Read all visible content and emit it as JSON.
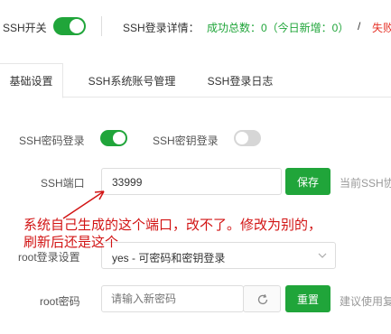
{
  "header": {
    "ssh_switch_label": "SSH开关",
    "detail_label": "SSH登录详情：",
    "success_text": "成功总数：0（今日新增：0）",
    "separator": "/",
    "fail_text": "失败"
  },
  "tabs": [
    {
      "label": "基础设置"
    },
    {
      "label": "SSH系统账号管理"
    },
    {
      "label": "SSH登录日志"
    }
  ],
  "settings": {
    "pwd_login_label": "SSH密码登录",
    "key_login_label": "SSH密钥登录",
    "port_label": "SSH端口",
    "port_value": "33999",
    "save_button": "保存",
    "current_ssh_hint": "当前SSH协",
    "root_login_label": "root登录设置",
    "root_login_value": "yes - 可密码和密钥登录",
    "root_pwd_label": "root密码",
    "root_pwd_placeholder": "请输入新密码",
    "reset_button": "重置",
    "suggest_hint": "建议使用复"
  },
  "annotation": {
    "line1": "系统自己生成的这个端口，改不了。修改为别的，",
    "line2": "刷新后还是这个"
  },
  "colors": {
    "accent": "#20a53a",
    "annotation": "#d21414",
    "fail": "#e6342a"
  }
}
